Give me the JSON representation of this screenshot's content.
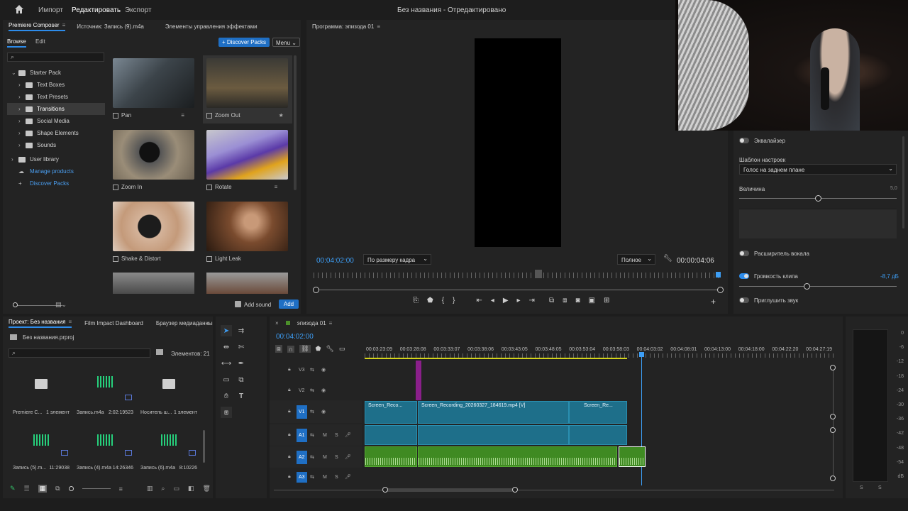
{
  "menu": {
    "items": [
      "Импорт",
      "Редактировать",
      "Экспорт"
    ],
    "active_index": 1,
    "window_title": "Без названия - Отредактировано"
  },
  "composer": {
    "tabs": [
      "Premiere Composer",
      "Источник: Запись (9).m4a",
      "Элементы управления эффектами"
    ],
    "subtabs": [
      "Browse",
      "Edit"
    ],
    "discover_button": "+ Discover Packs",
    "menu_button": "Menu",
    "tree": [
      {
        "label": "Starter Pack",
        "level": 0,
        "expanded": true
      },
      {
        "label": "Text Boxes",
        "level": 1
      },
      {
        "label": "Text Presets",
        "level": 1
      },
      {
        "label": "Transitions",
        "level": 1,
        "selected": true
      },
      {
        "label": "Social Media",
        "level": 1
      },
      {
        "label": "Shape Elements",
        "level": 1
      },
      {
        "label": "Sounds",
        "level": 1
      },
      {
        "label": "User library",
        "level": 0
      }
    ],
    "links": [
      "Manage products",
      "Discover Packs"
    ],
    "thumbs": [
      "Pan",
      "Zoom Out",
      "Zoom In",
      "Rotate",
      "Shake & Distort",
      "Light Leak"
    ],
    "add_sound_label": "Add sound",
    "add_button": "Add"
  },
  "program": {
    "title": "Программа: эпизода 01",
    "timecode_left": "00:04:02:00",
    "fit_select": "По размеру кадра",
    "quality_select": "Полное",
    "timecode_right": "00:00:04:06"
  },
  "audio_panel": {
    "equalizer_label": "Эквалайзер",
    "preset_label": "Шаблон настроек",
    "preset_value": "Голос на заднем плане",
    "amount_label": "Величина",
    "amount_value": "5,0",
    "vocal_label": "Расширитель вокала",
    "clip_volume_label": "Громкость клипа",
    "clip_volume_value": "-8,7 дБ",
    "duck_label": "Приглушить звук"
  },
  "project": {
    "tabs": [
      "Проект: Без названия",
      "Film Impact Dashboard",
      "Браузер медиаданны"
    ],
    "file_name": "Без названия.prproj",
    "count_label": "Элементов: 21",
    "items": [
      {
        "name": "Premiere C...",
        "meta": "1 элемент",
        "kind": "folder"
      },
      {
        "name": "Запись.m4a",
        "meta": "2:02:19523",
        "kind": "audio"
      },
      {
        "name": "Носитель ш...",
        "meta": "1 элемент",
        "kind": "folder"
      },
      {
        "name": "Запись (5).m...",
        "meta": "11:29038",
        "kind": "audio"
      },
      {
        "name": "Запись (4).m4a",
        "meta": "14:26346",
        "kind": "audio"
      },
      {
        "name": "Запись (6).m4a",
        "meta": "8:10226",
        "kind": "audio"
      }
    ]
  },
  "timeline": {
    "tab": "эпизода 01",
    "timecode": "00:04:02:00",
    "ruler": [
      "00:03:23:09",
      "00:03:28:08",
      "00:03:33:07",
      "00:03:38:06",
      "00:03:43:05",
      "00:03:48:05",
      "00:03:53:04",
      "00:03:58:03",
      "00:04:03:02",
      "00:04:08:01",
      "00:04:13:00",
      "00:04:18:00",
      "00:04:22:20",
      "00:04:27:19"
    ],
    "tracks": [
      "V3",
      "V2",
      "V1",
      "A1",
      "A2",
      "A3"
    ],
    "clips": [
      "Screen_Reco...",
      "Screen_Recording_20260327_184619.mp4 [V]",
      "Screen_Re..."
    ]
  },
  "meter": {
    "ticks": [
      "0",
      "-6",
      "-12",
      "-18",
      "-24",
      "-30",
      "-36",
      "-42",
      "-48",
      "-54",
      "dB"
    ],
    "solo": [
      "S",
      "S"
    ]
  }
}
